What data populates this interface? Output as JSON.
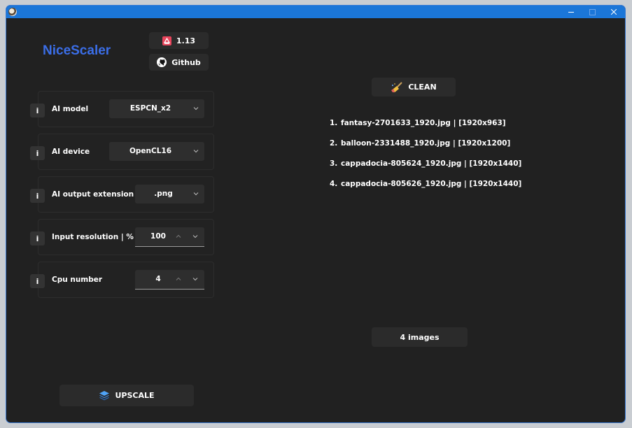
{
  "app": {
    "title": "NiceScaler"
  },
  "header": {
    "version_label": "1.13",
    "github_label": "Github"
  },
  "settings": {
    "ai_model": {
      "label": "AI model",
      "value": "ESPCN_x2"
    },
    "ai_device": {
      "label": "AI device",
      "value": "OpenCL16"
    },
    "ai_output_extension": {
      "label": "AI output extension",
      "value": ".png"
    },
    "input_resolution": {
      "label": "Input resolution | %",
      "value": "100"
    },
    "cpu_number": {
      "label": "Cpu number",
      "value": "4"
    },
    "info_label": "i"
  },
  "actions": {
    "clean_label": "CLEAN",
    "upscale_label": "UPSCALE"
  },
  "files": {
    "items": [
      {
        "num": "1.",
        "text": "fantasy-2701633_1920.jpg | [1920x963]"
      },
      {
        "num": "2.",
        "text": "balloon-2331488_1920.jpg | [1920x1200]"
      },
      {
        "num": "3.",
        "text": "cappadocia-805624_1920.jpg | [1920x1440]"
      },
      {
        "num": "4.",
        "text": "cappadocia-805626_1920.jpg | [1920x1440]"
      }
    ],
    "count_label": "4 images"
  },
  "icons": {
    "app": "app-icon",
    "version": "badge-icon",
    "github": "github-icon",
    "clean": "broom-icon",
    "upscale": "layers-icon"
  },
  "colors": {
    "accent": "#3b6ee8",
    "titlebar": "#1b76d8",
    "background": "#212121"
  }
}
